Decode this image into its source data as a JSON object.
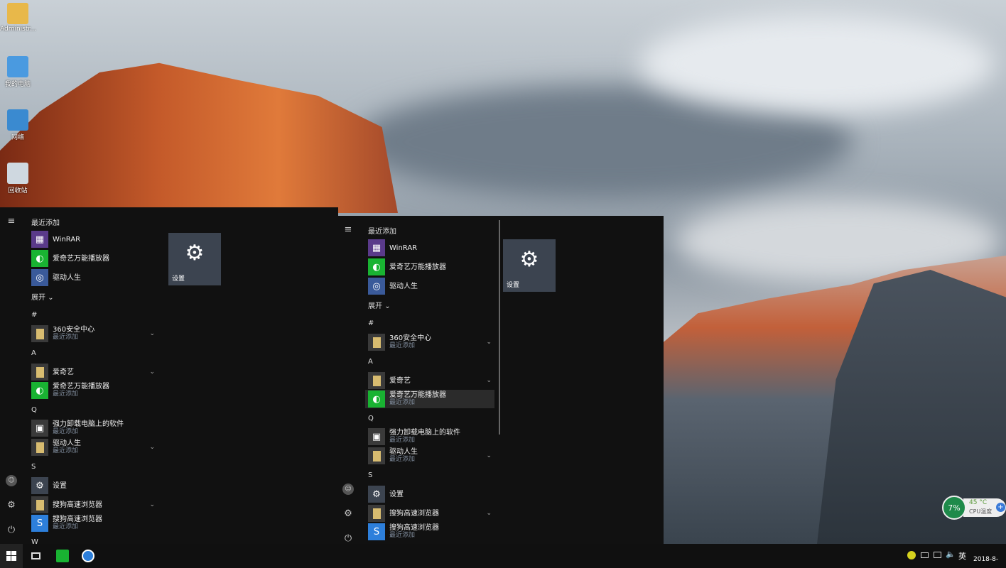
{
  "desktop": {
    "icons": [
      {
        "label": "Administr..."
      },
      {
        "label": "我的电脑"
      },
      {
        "label": "网络"
      },
      {
        "label": "回收站"
      }
    ]
  },
  "start_menu": {
    "items": [
      {
        "type": "header",
        "label": "最近添加"
      },
      {
        "type": "app",
        "label": "WinRAR",
        "icon": "winrar-icon"
      },
      {
        "type": "app",
        "label": "爱奇艺万能播放器",
        "icon": "iqiyi-icon"
      },
      {
        "type": "app",
        "label": "驱动人生",
        "icon": "driver-icon"
      },
      {
        "type": "expand",
        "label": "展开"
      },
      {
        "type": "letter",
        "label": "#"
      },
      {
        "type": "folder",
        "label": "360安全中心",
        "sub": "最近添加"
      },
      {
        "type": "letter",
        "label": "A"
      },
      {
        "type": "folder",
        "label": "爱奇艺"
      },
      {
        "type": "app2",
        "label": "爱奇艺万能播放器",
        "sub": "最近添加",
        "icon": "iqiyi-icon"
      },
      {
        "type": "letter",
        "label": "Q"
      },
      {
        "type": "app2",
        "label": "强力卸载电脑上的软件",
        "sub": "最近添加",
        "icon": "uninstall-icon"
      },
      {
        "type": "folder",
        "label": "驱动人生",
        "sub": "最近添加"
      },
      {
        "type": "letter",
        "label": "S"
      },
      {
        "type": "app",
        "label": "设置",
        "icon": "settings-icon"
      },
      {
        "type": "folder",
        "label": "搜狗高速浏览器"
      },
      {
        "type": "app2",
        "label": "搜狗高速浏览器",
        "sub": "最近添加",
        "icon": "sogou-icon"
      },
      {
        "type": "letter",
        "label": "W"
      }
    ],
    "tile_label": "设置"
  },
  "widget": {
    "cpu_usage": "7%",
    "temp": "45 °C",
    "temp_label": "CPU温度"
  },
  "tray": {
    "ime": "英",
    "clock": "2018-8-"
  },
  "colors": {
    "accent": "#3c4450",
    "menu_bg": "#111111",
    "taskbar": "#101010"
  }
}
